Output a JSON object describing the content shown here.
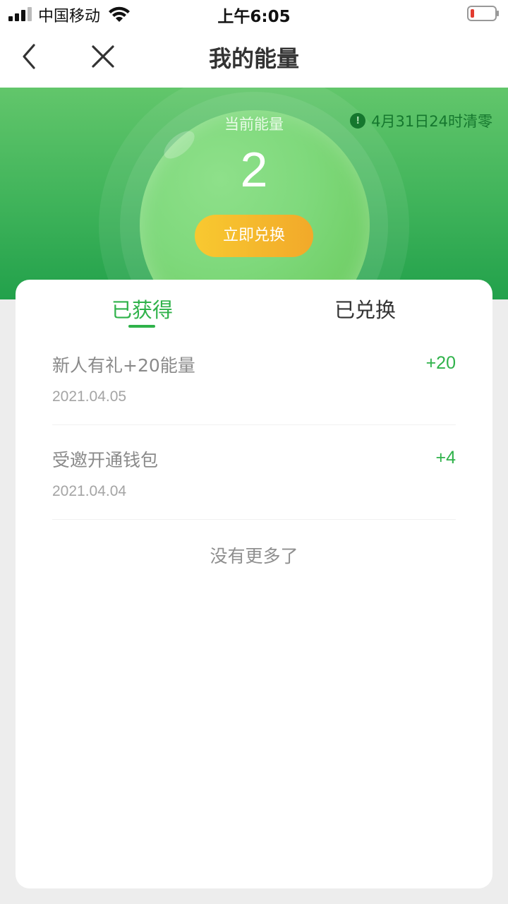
{
  "status_bar": {
    "carrier": "中国移动",
    "time": "上午6:05"
  },
  "nav": {
    "title": "我的能量",
    "back_icon": "chevron-left-icon",
    "close_icon": "close-icon"
  },
  "energy": {
    "label": "当前能量",
    "value": "2",
    "redeem_label": "立即兑换",
    "expiry_notice": "4月31日24时清零",
    "info_icon": "!"
  },
  "tabs": [
    {
      "label": "已获得",
      "active": true
    },
    {
      "label": "已兑换",
      "active": false
    }
  ],
  "records": [
    {
      "title": "新人有礼+20能量",
      "date": "2021.04.05",
      "amount": "+20"
    },
    {
      "title": "受邀开通钱包",
      "date": "2021.04.04",
      "amount": "+4"
    }
  ],
  "footer_text": "没有更多了",
  "colors": {
    "accent": "#2fb24a",
    "header_green": "#3fb35a",
    "button_gold": "#f5b82c"
  }
}
